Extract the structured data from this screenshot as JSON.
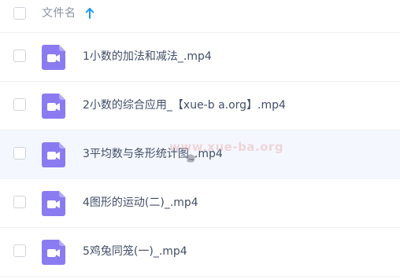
{
  "header": {
    "column_label": "文件名",
    "sort_direction": "ascending",
    "sort_icon": "arrow-up-icon",
    "sort_color": "#1a9bf0"
  },
  "files": [
    {
      "name": "1小数的加法和减法_.mp4"
    },
    {
      "name": "2小数的综合应用_【xue-b a.org】.mp4"
    },
    {
      "name": "3平均数与条形统计图_.mp4"
    },
    {
      "name": "4图形的运动(二)_.mp4"
    },
    {
      "name": "5鸡兔同笼(一)_.mp4"
    }
  ],
  "file_icon": {
    "name": "video-file-icon",
    "color": "#8a7cf0"
  },
  "watermark": {
    "text": "www.xue-ba.org",
    "icon": "graduation-cap-icon"
  }
}
